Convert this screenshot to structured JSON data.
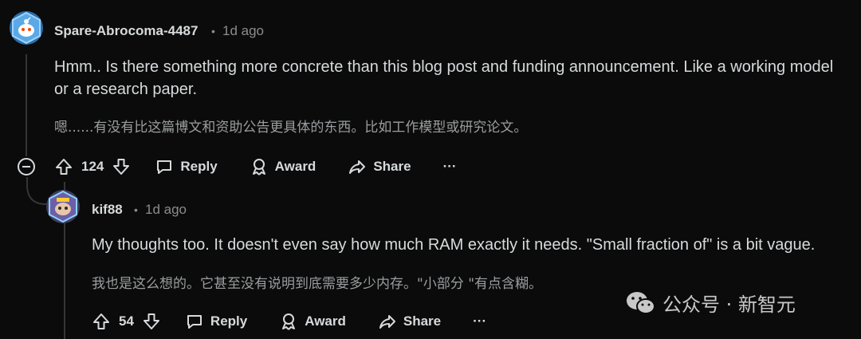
{
  "comments": [
    {
      "username": "Spare-Abrocoma-4487",
      "dot": "•",
      "time": "1d ago",
      "body_line1": "Hmm.. Is there something more concrete than this blog post and funding announcement. Like a working model",
      "body_line2": "or a research paper.",
      "translation": "嗯......有没有比这篇博文和资助公告更具体的东西。比如工作模型或研究论文。",
      "votes": "124",
      "reply_label": "Reply",
      "award_label": "Award",
      "share_label": "Share",
      "more_label": "···"
    },
    {
      "username": "kif88",
      "dot": "•",
      "time": "1d ago",
      "body_line1": "My thoughts too. It doesn't even say how much RAM exactly it needs. \"Small fraction of\" is a bit vague.",
      "translation": "我也是这么想的。它甚至没有说明到底需要多少内存。\"小部分 \"有点含糊。",
      "votes": "54",
      "reply_label": "Reply",
      "award_label": "Award",
      "share_label": "Share",
      "more_label": "···"
    }
  ],
  "watermark": {
    "text": "公众号 · 新智元",
    "icon": "wechat-icon"
  },
  "colors": {
    "background": "#0b0b0b",
    "text": "#d7dadc",
    "muted": "#8a8d8f",
    "thread_line": "#343536"
  }
}
